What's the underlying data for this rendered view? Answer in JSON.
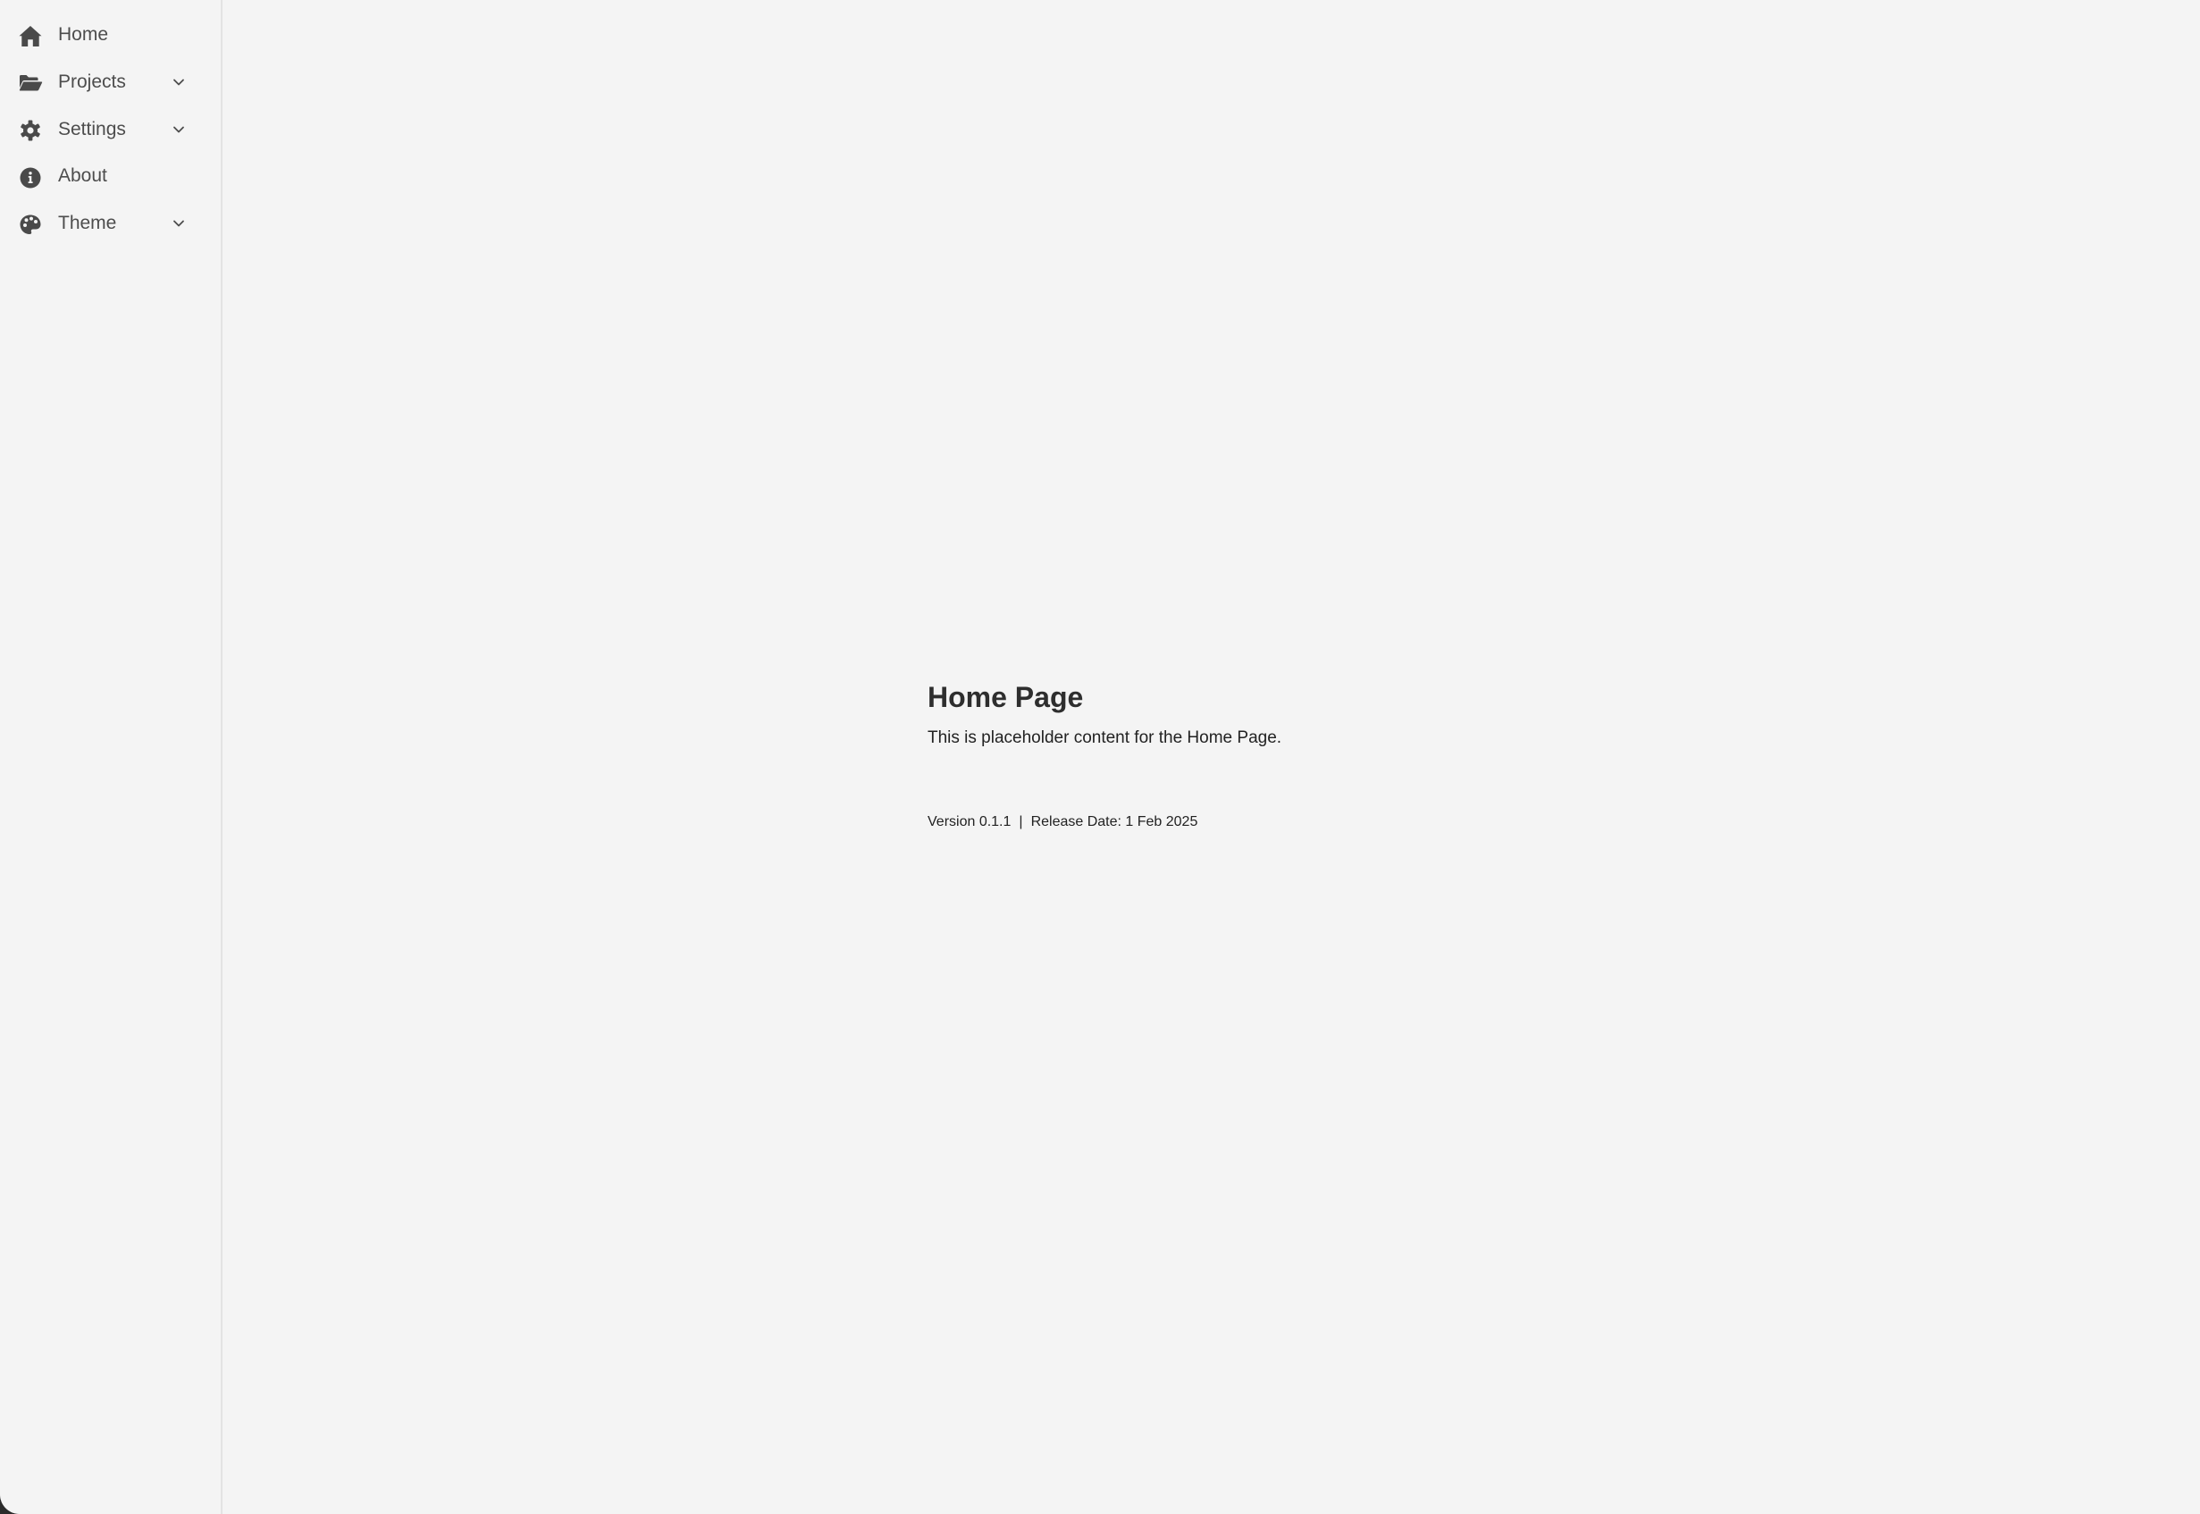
{
  "sidebar": {
    "items": [
      {
        "label": "Home",
        "icon": "home-icon",
        "expandable": false
      },
      {
        "label": "Projects",
        "icon": "folder-open-icon",
        "expandable": true
      },
      {
        "label": "Settings",
        "icon": "gear-icon",
        "expandable": true
      },
      {
        "label": "About",
        "icon": "info-circle-icon",
        "expandable": false
      },
      {
        "label": "Theme",
        "icon": "palette-icon",
        "expandable": true
      }
    ]
  },
  "main": {
    "title": "Home Page",
    "description": "This is placeholder content for the Home Page.",
    "version": "Version 0.1.1",
    "separator": "|",
    "release_date": "Release Date: 1 Feb 2025"
  },
  "colors": {
    "background": "#f4f4f4",
    "sidebar_border": "#e3e3e3",
    "nav_text": "#4d4d4d",
    "icon": "#4a4a4a",
    "heading": "#2e2e2e"
  }
}
